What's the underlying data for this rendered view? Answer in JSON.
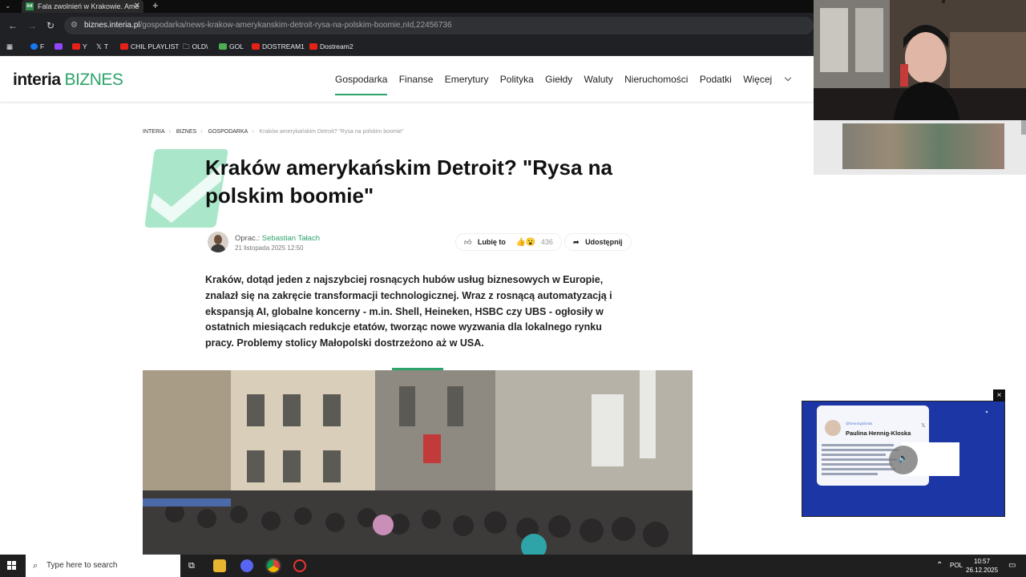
{
  "browser": {
    "tab_title": "Fala zwolnień w Krakowie. Ame",
    "tab_favicon": "int",
    "url_host": "biznes.interia.pl",
    "url_path": "/gospodarka/news-krakow-amerykanskim-detroit-rysa-na-polskim-boomie,nId,22456736",
    "bookmarks": [
      "F",
      "",
      "Y",
      "T",
      "CHIL PLAYLIST",
      "OLD\\",
      "GOL",
      "DOSTREAM1",
      "Dostream2"
    ]
  },
  "site": {
    "logo_main": "interia",
    "logo_section": "BIZNES",
    "nav": [
      "Gospodarka",
      "Finanse",
      "Emerytury",
      "Polityka",
      "Giełdy",
      "Waluty",
      "Nieruchomości",
      "Podatki",
      "Więcej"
    ]
  },
  "breadcrumbs": [
    "INTERIA",
    "BIZNES",
    "GOSPODARKA",
    "Kraków amerykańskim Detroit? \"Rysa na polskim boomie\""
  ],
  "article": {
    "title": "Kraków amerykańskim Detroit? \"Rysa na polskim boomie\"",
    "author_prefix": "Oprac.:",
    "author_name": "Sebastian Tałach",
    "date": "21 listopada 2025 12:50",
    "like_label": "Lubię to",
    "like_count": "436",
    "share_label": "Udostępnij",
    "lead": "Kraków, dotąd jeden z najszybciej rosnących hubów usług biznesowych w Europie, znalazł się na zakręcie transformacji technologicznej. Wraz z rosnącą automatyzacją i ekspansją AI, globalne koncerny - m.in. Shell, Heineken, HSBC czy UBS - ogłosiły w ostatnich miesiącach redukcje etatów, tworząc nowe wyzwania dla lokalnego rynku pracy. Problemy stolicy Małopolski dostrzeżono aż w USA."
  },
  "ad": {
    "tweet_handle": "@henningkloska",
    "tweet_name": "Paulina Hennig-Kloska",
    "close_label": "×"
  },
  "taskbar": {
    "search_placeholder": "Type here to search",
    "language": "POL",
    "time": "10:57",
    "date": "26.12.2025"
  },
  "colors": {
    "brand_green": "#2da36b",
    "ad_blue": "#1c36a6"
  }
}
